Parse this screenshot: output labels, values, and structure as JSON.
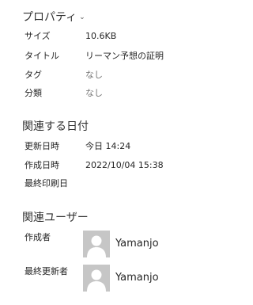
{
  "properties": {
    "title": "プロパティ",
    "items": [
      {
        "label": "サイズ",
        "value": "10.6KB",
        "muted": false
      },
      {
        "label": "タイトル",
        "value": "リーマン予想の証明",
        "muted": false
      },
      {
        "label": "タグ",
        "value": "なし",
        "muted": true
      },
      {
        "label": "分類",
        "value": "なし",
        "muted": true
      }
    ]
  },
  "dates": {
    "title": "関連する日付",
    "items": [
      {
        "label": "更新日時",
        "value": "今日 14:24"
      },
      {
        "label": "作成日時",
        "value": "2022/10/04 15:38"
      },
      {
        "label": "最終印刷日",
        "value": ""
      }
    ]
  },
  "users": {
    "title": "関連ユーザー",
    "items": [
      {
        "label": "作成者",
        "name": "Yamanjo"
      },
      {
        "label": "最終更新者",
        "name": "Yamanjo"
      }
    ]
  }
}
